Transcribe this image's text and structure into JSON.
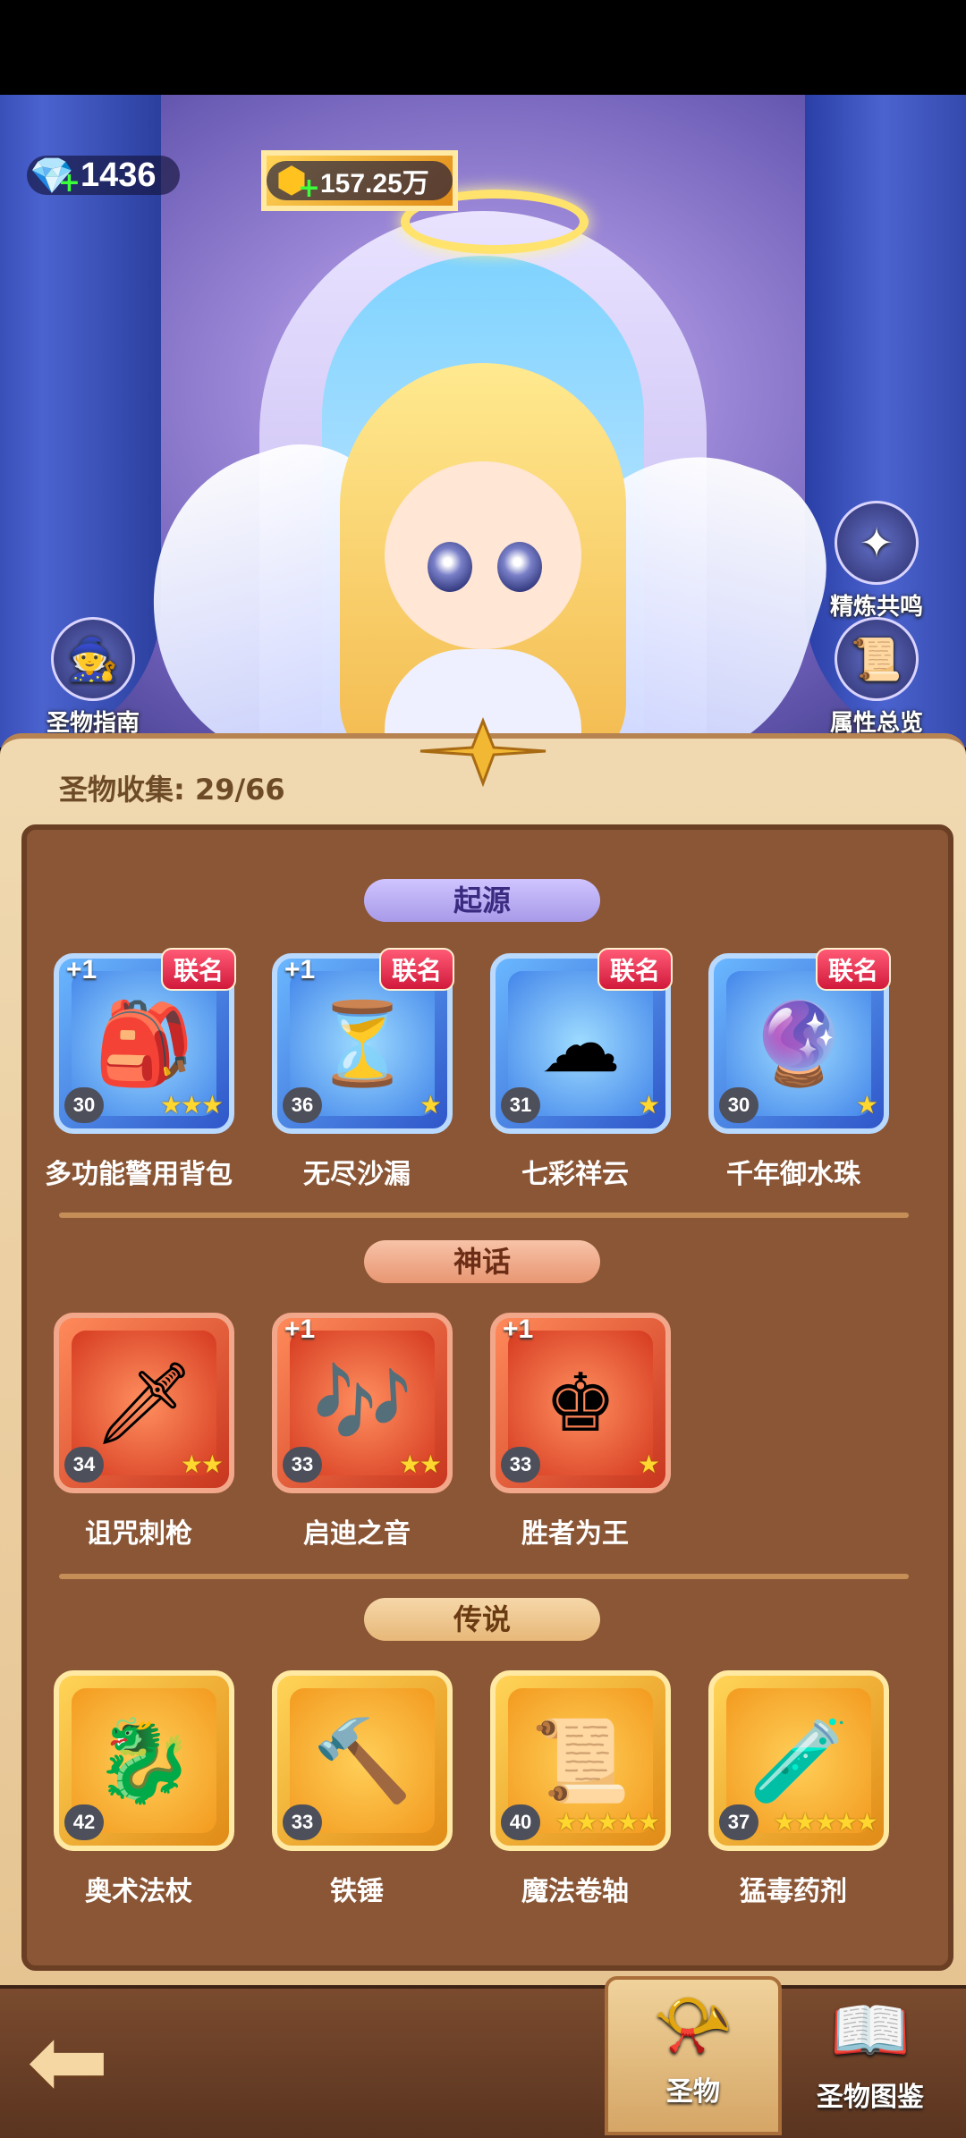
{
  "resources": {
    "gems": "1436",
    "gold": "157.25万"
  },
  "side_buttons": {
    "guide": "圣物指南",
    "refine": "精炼共鸣",
    "attributes": "属性总览"
  },
  "collection": {
    "label": "圣物收集: 29/66"
  },
  "sections": [
    {
      "title": "起源",
      "items": [
        {
          "name": "多功能警用背包",
          "level": "30",
          "stars": "★★★",
          "plus": "+1",
          "tag": "联名",
          "icon": "backpack-icon"
        },
        {
          "name": "无尽沙漏",
          "level": "36",
          "stars": "★",
          "plus": "+1",
          "tag": "联名",
          "icon": "hourglass-icon"
        },
        {
          "name": "七彩祥云",
          "level": "31",
          "stars": "★",
          "plus": "",
          "tag": "联名",
          "icon": "cloud-icon"
        },
        {
          "name": "千年御水珠",
          "level": "30",
          "stars": "★",
          "plus": "",
          "tag": "联名",
          "icon": "water-orb-icon"
        }
      ]
    },
    {
      "title": "神话",
      "items": [
        {
          "name": "诅咒刺枪",
          "level": "34",
          "stars": "★★",
          "plus": "",
          "tag": "",
          "icon": "spear-icon"
        },
        {
          "name": "启迪之音",
          "level": "33",
          "stars": "★★",
          "plus": "+1",
          "tag": "",
          "icon": "harp-icon"
        },
        {
          "name": "胜者为王",
          "level": "33",
          "stars": "★",
          "plus": "+1",
          "tag": "",
          "icon": "chess-king-icon"
        }
      ]
    },
    {
      "title": "传说",
      "items": [
        {
          "name": "奥术法杖",
          "level": "42",
          "stars": "",
          "plus": "",
          "tag": "",
          "icon": "staff-icon"
        },
        {
          "name": "铁锤",
          "level": "33",
          "stars": "",
          "plus": "",
          "tag": "",
          "icon": "hammer-icon"
        },
        {
          "name": "魔法卷轴",
          "level": "40",
          "stars": "★★★★★",
          "plus": "",
          "tag": "",
          "icon": "scroll-icon"
        },
        {
          "name": "猛毒药剂",
          "level": "37",
          "stars": "★★★★★",
          "plus": "",
          "tag": "",
          "icon": "potion-icon"
        }
      ]
    }
  ],
  "tabs": {
    "relics": "圣物",
    "codex": "圣物图鉴"
  }
}
